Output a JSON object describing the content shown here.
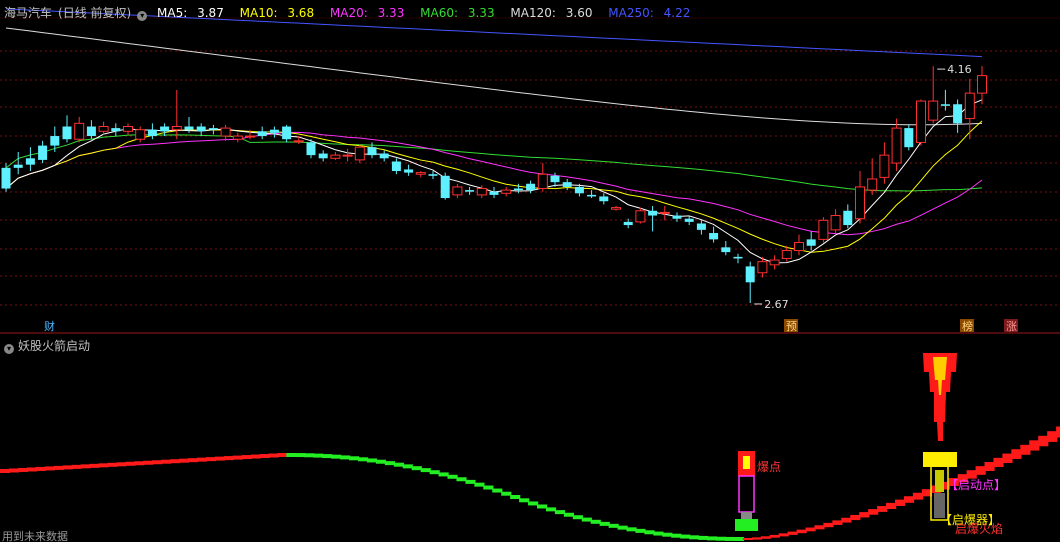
{
  "header": {
    "title": "海马汽车",
    "period": "(日线 前复权)",
    "ma": [
      {
        "label": "MA5:",
        "value": "3.87",
        "color": "#ffffff"
      },
      {
        "label": "MA10:",
        "value": "3.68",
        "color": "#ffff00"
      },
      {
        "label": "MA20:",
        "value": "3.33",
        "color": "#ff33ff"
      },
      {
        "label": "MA60:",
        "value": "3.33",
        "color": "#33dd33"
      },
      {
        "label": "MA120:",
        "value": "3.60",
        "color": "#dddddd"
      },
      {
        "label": "MA250:",
        "value": "4.22",
        "color": "#4455ff"
      }
    ]
  },
  "indicator": {
    "title": "妖股火箭启动",
    "labels": {
      "explosion": "爆点",
      "start": "【启动点】",
      "detonator": "【启爆器】",
      "flame": "启爆火焰"
    }
  },
  "footer": {
    "note": "用到未来数据"
  },
  "markers": {
    "cai": "财",
    "yu": "预",
    "bang": "榜",
    "zhang": "涨"
  },
  "chart_data": {
    "type": "candlestick",
    "y_range": [
      2.5,
      4.45
    ],
    "annotations": {
      "high_label": "4.16",
      "low_label": "2.67"
    },
    "candles": [
      [
        3.52,
        3.39,
        3.55,
        3.37
      ],
      [
        3.54,
        3.52,
        3.62,
        3.48
      ],
      [
        3.58,
        3.54,
        3.65,
        3.5
      ],
      [
        3.66,
        3.57,
        3.69,
        3.55
      ],
      [
        3.72,
        3.66,
        3.78,
        3.62
      ],
      [
        3.78,
        3.7,
        3.85,
        3.68
      ],
      [
        3.7,
        3.8,
        3.84,
        3.68
      ],
      [
        3.78,
        3.72,
        3.82,
        3.7
      ],
      [
        3.75,
        3.78,
        3.81,
        3.73
      ],
      [
        3.77,
        3.75,
        3.8,
        3.72
      ],
      [
        3.75,
        3.78,
        3.8,
        3.73
      ],
      [
        3.7,
        3.76,
        3.78,
        3.68
      ],
      [
        3.76,
        3.72,
        3.8,
        3.7
      ],
      [
        3.78,
        3.75,
        3.8,
        3.72
      ],
      [
        3.76,
        3.78,
        4.01,
        3.7
      ],
      [
        3.78,
        3.76,
        3.84,
        3.74
      ],
      [
        3.78,
        3.75,
        3.8,
        3.72
      ],
      [
        3.77,
        3.76,
        3.79,
        3.73
      ],
      [
        3.72,
        3.77,
        3.79,
        3.69
      ],
      [
        3.7,
        3.72,
        3.74,
        3.68
      ],
      [
        3.72,
        3.72,
        3.76,
        3.7
      ],
      [
        3.75,
        3.72,
        3.78,
        3.7
      ],
      [
        3.76,
        3.74,
        3.78,
        3.71
      ],
      [
        3.78,
        3.7,
        3.79,
        3.68
      ],
      [
        3.69,
        3.69,
        3.72,
        3.67
      ],
      [
        3.68,
        3.6,
        3.7,
        3.58
      ],
      [
        3.61,
        3.58,
        3.63,
        3.56
      ],
      [
        3.58,
        3.6,
        3.62,
        3.57
      ],
      [
        3.6,
        3.6,
        3.64,
        3.56
      ],
      [
        3.57,
        3.65,
        3.67,
        3.55
      ],
      [
        3.65,
        3.6,
        3.68,
        3.58
      ],
      [
        3.61,
        3.58,
        3.63,
        3.56
      ],
      [
        3.56,
        3.5,
        3.58,
        3.48
      ],
      [
        3.51,
        3.49,
        3.54,
        3.47
      ],
      [
        3.48,
        3.49,
        3.5,
        3.46
      ],
      [
        3.48,
        3.47,
        3.5,
        3.45
      ],
      [
        3.47,
        3.33,
        3.49,
        3.32
      ],
      [
        3.35,
        3.4,
        3.42,
        3.33
      ],
      [
        3.38,
        3.37,
        3.4,
        3.35
      ],
      [
        3.35,
        3.39,
        3.41,
        3.33
      ],
      [
        3.37,
        3.35,
        3.4,
        3.33
      ],
      [
        3.36,
        3.38,
        3.4,
        3.34
      ],
      [
        3.39,
        3.38,
        3.42,
        3.36
      ],
      [
        3.42,
        3.38,
        3.44,
        3.36
      ],
      [
        3.39,
        3.48,
        3.55,
        3.37
      ],
      [
        3.47,
        3.43,
        3.49,
        3.4
      ],
      [
        3.43,
        3.4,
        3.45,
        3.38
      ],
      [
        3.4,
        3.36,
        3.42,
        3.34
      ],
      [
        3.35,
        3.34,
        3.38,
        3.33
      ],
      [
        3.34,
        3.31,
        3.36,
        3.29
      ],
      [
        3.26,
        3.27,
        3.28,
        3.25
      ],
      [
        3.18,
        3.16,
        3.2,
        3.14
      ],
      [
        3.18,
        3.25,
        3.27,
        3.17
      ],
      [
        3.25,
        3.22,
        3.28,
        3.12
      ],
      [
        3.24,
        3.24,
        3.28,
        3.19
      ],
      [
        3.22,
        3.2,
        3.24,
        3.18
      ],
      [
        3.2,
        3.18,
        3.22,
        3.16
      ],
      [
        3.17,
        3.13,
        3.19,
        3.1
      ],
      [
        3.11,
        3.07,
        3.15,
        3.05
      ],
      [
        3.02,
        2.99,
        3.06,
        2.97
      ],
      [
        2.96,
        2.95,
        2.98,
        2.92
      ],
      [
        2.9,
        2.8,
        2.93,
        2.67
      ],
      [
        2.86,
        2.93,
        2.96,
        2.83
      ],
      [
        2.91,
        2.94,
        2.97,
        2.88
      ],
      [
        2.95,
        3.0,
        3.03,
        2.93
      ],
      [
        3.0,
        3.05,
        3.1,
        2.97
      ],
      [
        3.07,
        3.03,
        3.12,
        3.0
      ],
      [
        3.07,
        3.19,
        3.21,
        3.05
      ],
      [
        3.13,
        3.22,
        3.26,
        3.1
      ],
      [
        3.25,
        3.16,
        3.29,
        3.14
      ],
      [
        3.2,
        3.4,
        3.5,
        3.17
      ],
      [
        3.38,
        3.45,
        3.58,
        3.35
      ],
      [
        3.46,
        3.6,
        3.68,
        3.42
      ],
      [
        3.55,
        3.77,
        3.83,
        3.5
      ],
      [
        3.77,
        3.65,
        3.79,
        3.63
      ],
      [
        3.68,
        3.94,
        3.95,
        3.66
      ],
      [
        3.82,
        3.94,
        4.16,
        3.8
      ],
      [
        3.92,
        3.91,
        4.01,
        3.88
      ],
      [
        3.92,
        3.8,
        3.95,
        3.74
      ],
      [
        3.83,
        3.99,
        4.08,
        3.7
      ],
      [
        3.99,
        4.1,
        4.16,
        3.92
      ]
    ],
    "indicator": {
      "segments": [
        {
          "from": 0,
          "to": 31,
          "color": "#ff1a1a",
          "y0": 471,
          "y1": 455
        },
        {
          "from": 32,
          "to": 82,
          "color": "#22ee22",
          "y0": 455,
          "y1": 539
        },
        {
          "from": 83,
          "to": 118,
          "color": "#ff1a1a",
          "y0": 539,
          "y1": 432
        }
      ]
    }
  }
}
